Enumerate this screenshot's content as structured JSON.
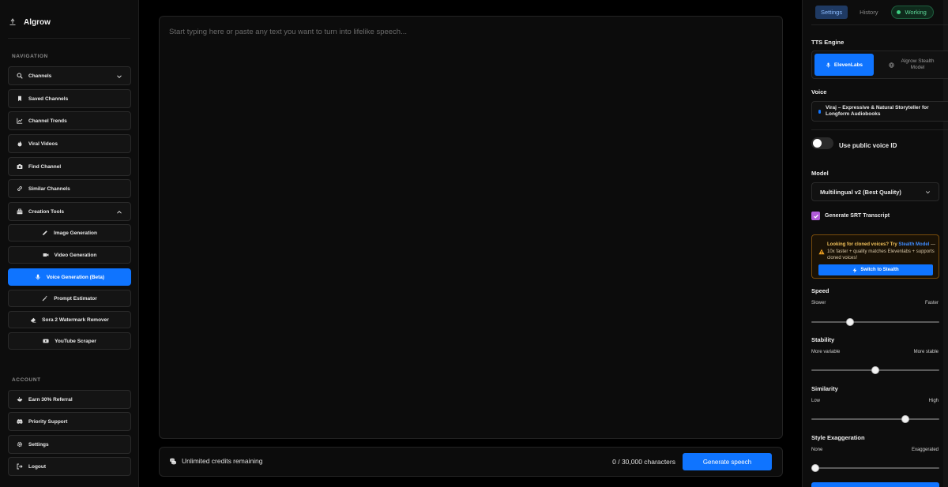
{
  "brand": {
    "name": "Algrow"
  },
  "sidebar": {
    "navigation_label": "NAVIGATION",
    "account_label": "ACCOUNT",
    "nav": [
      {
        "label": "Channels",
        "icon": "search-icon"
      },
      {
        "label": "Saved Channels",
        "icon": "bookmark-icon"
      },
      {
        "label": "Channel Trends",
        "icon": "trend-chart-icon"
      },
      {
        "label": "Viral Videos",
        "icon": "flame-icon"
      },
      {
        "label": "Find Channel",
        "icon": "camera-icon"
      },
      {
        "label": "Similar Channels",
        "icon": "link-icon"
      },
      {
        "label": "Creation Tools",
        "icon": "toolbox-icon"
      }
    ],
    "tools": [
      {
        "label": "Image Generation",
        "icon": "pencil-icon"
      },
      {
        "label": "Video Generation",
        "icon": "video-icon"
      },
      {
        "label": "Voice Generation (Beta)",
        "icon": "mic-icon"
      },
      {
        "label": "Prompt Estimator",
        "icon": "magic-wand-icon"
      },
      {
        "label": "Sora 2 Watermark Remover",
        "icon": "eraser-icon"
      },
      {
        "label": "YouTube Scraper",
        "icon": "youtube-icon"
      }
    ],
    "account": [
      {
        "label": "Earn 30% Referral",
        "icon": "handshake-icon"
      },
      {
        "label": "Priority Support",
        "icon": "discord-icon"
      },
      {
        "label": "Settings",
        "icon": "gear-icon"
      },
      {
        "label": "Logout",
        "icon": "logout-icon"
      }
    ]
  },
  "editor": {
    "placeholder": "Start typing here or paste any text you want to turn into lifelike speech...",
    "value": ""
  },
  "footer": {
    "credits": "Unlimited credits remaining",
    "char_count": "0 / 30,000 characters",
    "generate_label": "Generate speech"
  },
  "panel": {
    "tabs": [
      {
        "label": "Settings",
        "active": true
      },
      {
        "label": "History",
        "active": false
      }
    ],
    "status": "Working",
    "tts_engine_label": "TTS Engine",
    "engines": {
      "elevenlabs": "ElevenLabs",
      "stealth": "Algrow Stealth Model"
    },
    "voice_label": "Voice",
    "voice_value": "Viraj – Expressive & Natural Storyteller for Longform Audiobooks",
    "public_voice_label": "Use public voice ID",
    "public_voice_on": false,
    "model_label": "Model",
    "model_value": "Multilingual v2 (Best Quality)",
    "srt_label": "Generate SRT Transcript",
    "srt_checked": true,
    "warning": {
      "lead": "Looking for cloned voices? Try",
      "link": "Stealth Model",
      "rest": "— 10x faster + quality matches Elevenlabs + supports cloned voices!",
      "button": "Switch to Stealth"
    },
    "sliders": {
      "speed": {
        "label": "Speed",
        "min_label": "Slower",
        "max_label": "Faster",
        "value": 0.29
      },
      "stability": {
        "label": "Stability",
        "min_label": "More variable",
        "max_label": "More stable",
        "value": 0.5
      },
      "similarity": {
        "label": "Similarity",
        "min_label": "Low",
        "max_label": "High",
        "value": 0.75
      },
      "style": {
        "label": "Style Exaggeration",
        "min_label": "None",
        "max_label": "Exaggerated",
        "value": 0.0
      }
    }
  },
  "colors": {
    "accent": "#0f74ff",
    "status_green": "#3ecf82",
    "checkbox": "#b15bd8",
    "warning_border": "#7a4c0b"
  }
}
